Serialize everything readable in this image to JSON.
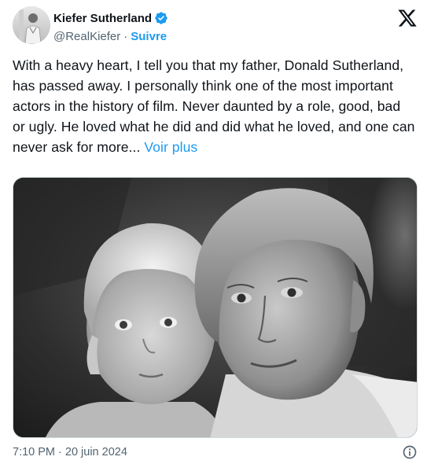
{
  "author": {
    "display_name": "Kiefer Sutherland",
    "handle": "@RealKiefer",
    "separator": "·",
    "follow_label": "Suivre",
    "avatar_icon": "profile-avatar",
    "verified_icon": "verified-badge-icon"
  },
  "brand_icon": "x-logo-icon",
  "tweet": {
    "text": "With a heavy heart, I tell you that my father, Donald Sutherland, has passed away. I personally think one of the most important actors in the history of film. Never daunted by a role, good, bad or ugly. He loved what he did and did what he loved, and one can never ask for more...",
    "see_more_label": "Voir plus"
  },
  "media": {
    "kind": "black-and-white photograph"
  },
  "footer": {
    "timestamp": "7:10 PM · 20 juin 2024",
    "info_icon": "info-icon"
  },
  "colors": {
    "text": "#0f1419",
    "muted": "#536471",
    "accent": "#1d9bf0",
    "border": "#cfd9de"
  }
}
